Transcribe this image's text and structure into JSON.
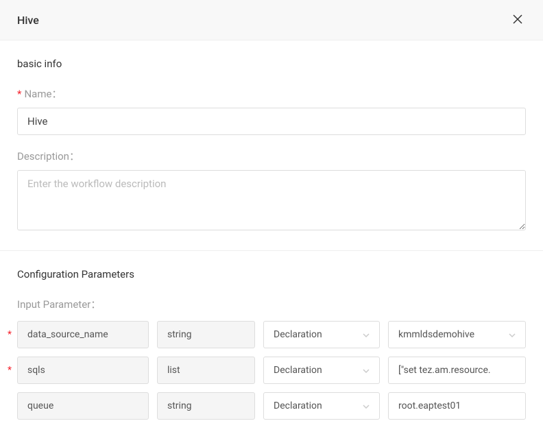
{
  "header": {
    "title": "Hive"
  },
  "basic_info": {
    "section_title": "basic info",
    "name_label": "Name：",
    "name_value": "Hive",
    "description_label": "Description：",
    "description_placeholder": "Enter the workflow description",
    "description_value": ""
  },
  "config": {
    "section_title": "Configuration Parameters",
    "input_param_label": "Input Parameter：",
    "params": [
      {
        "required": true,
        "name": "data_source_name",
        "type": "string",
        "mode": "Declaration",
        "value": "kmmldsdemohive",
        "value_is_select": true
      },
      {
        "required": true,
        "name": "sqls",
        "type": "list",
        "mode": "Declaration",
        "value": "[\"set tez.am.resource.",
        "value_is_select": false
      },
      {
        "required": false,
        "name": "queue",
        "type": "string",
        "mode": "Declaration",
        "value": "root.eaptest01",
        "value_is_select": false
      }
    ]
  }
}
